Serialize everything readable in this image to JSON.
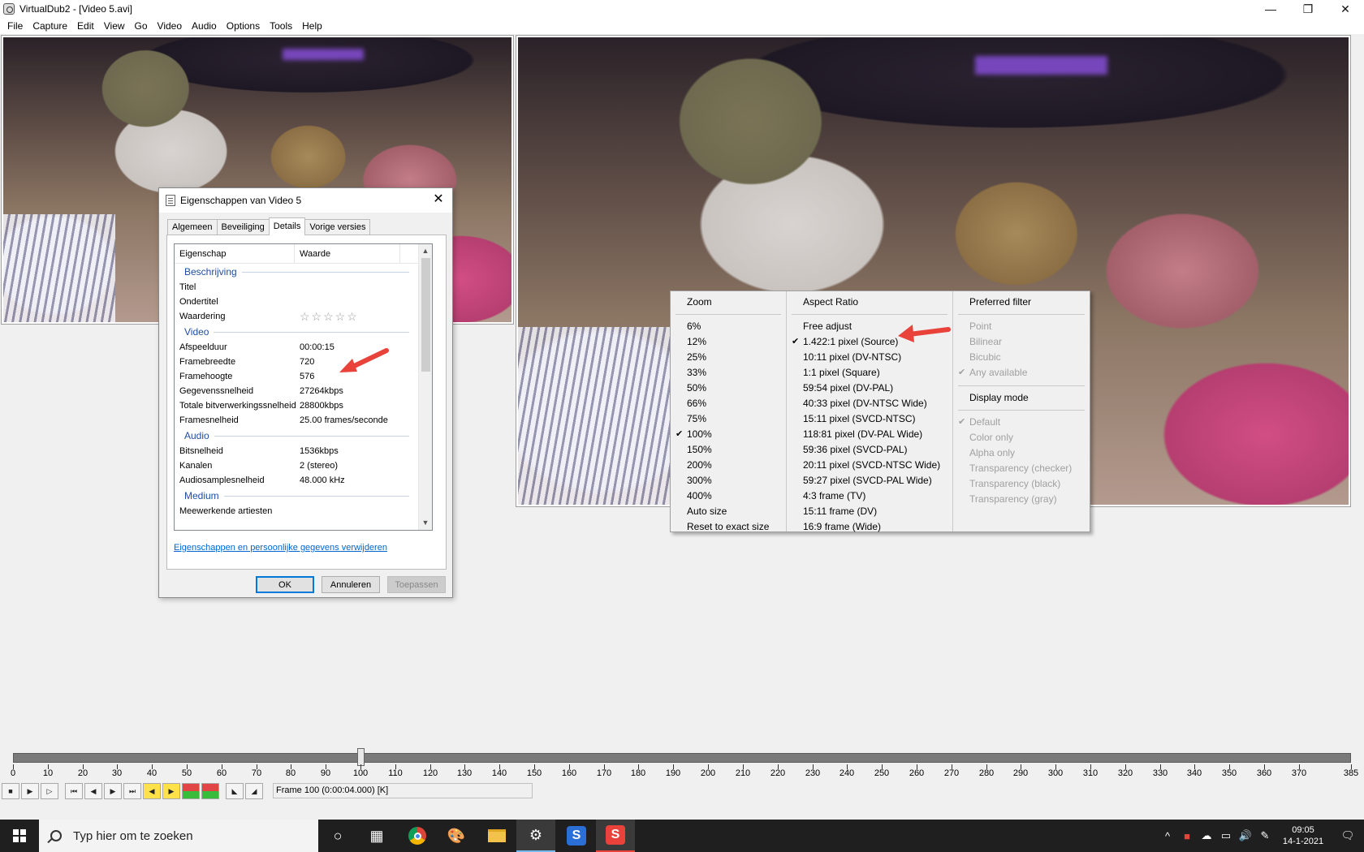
{
  "window": {
    "title": "VirtualDub2  - [Video 5.avi]",
    "controls": {
      "minimize": "—",
      "restore": "❐",
      "close": "✕"
    }
  },
  "menubar": [
    "File",
    "Capture",
    "Edit",
    "View",
    "Go",
    "Video",
    "Audio",
    "Options",
    "Tools",
    "Help"
  ],
  "props_dialog": {
    "title": "Eigenschappen van Video 5",
    "close": "✕",
    "tabs": [
      "Algemeen",
      "Beveiliging",
      "Details",
      "Vorige versies"
    ],
    "active_tab": "Details",
    "columns": [
      "Eigenschap",
      "Waarde"
    ],
    "groups": [
      {
        "name": "Beschrijving",
        "rows": [
          {
            "k": "Titel",
            "v": ""
          },
          {
            "k": "Ondertitel",
            "v": ""
          },
          {
            "k": "Waardering",
            "v": "☆☆☆☆☆"
          }
        ]
      },
      {
        "name": "Video",
        "rows": [
          {
            "k": "Afspeelduur",
            "v": "00:00:15"
          },
          {
            "k": "Framebreedte",
            "v": "720"
          },
          {
            "k": "Framehoogte",
            "v": "576"
          },
          {
            "k": "Gegevenssnelheid",
            "v": "27264kbps"
          },
          {
            "k": "Totale bitverwerkingssnelheid",
            "v": "28800kbps"
          },
          {
            "k": "Framesnelheid",
            "v": "25.00 frames/seconde"
          }
        ]
      },
      {
        "name": "Audio",
        "rows": [
          {
            "k": "Bitsnelheid",
            "v": "1536kbps"
          },
          {
            "k": "Kanalen",
            "v": "2 (stereo)"
          },
          {
            "k": "Audiosamplesnelheid",
            "v": "48.000 kHz"
          }
        ]
      },
      {
        "name": "Medium",
        "rows": [
          {
            "k": "Meewerkende artiesten",
            "v": ""
          }
        ]
      }
    ],
    "link": "Eigenschappen en persoonlijke gegevens verwijderen",
    "buttons": {
      "ok": "OK",
      "cancel": "Annuleren",
      "apply": "Toepassen"
    }
  },
  "context_menu": {
    "zoom": {
      "header": "Zoom",
      "items": [
        "6%",
        "12%",
        "25%",
        "33%",
        "50%",
        "66%",
        "75%",
        "100%",
        "150%",
        "200%",
        "300%",
        "400%",
        "Auto size",
        "Reset to exact size"
      ],
      "checked": "100%"
    },
    "aspect": {
      "header": "Aspect Ratio",
      "items": [
        "Free adjust",
        "1.422:1 pixel (Source)",
        "10:11 pixel (DV-NTSC)",
        "1:1 pixel (Square)",
        "59:54 pixel (DV-PAL)",
        "40:33 pixel (DV-NTSC Wide)",
        "15:11 pixel (SVCD-NTSC)",
        "118:81 pixel (DV-PAL Wide)",
        "59:36 pixel (SVCD-PAL)",
        "20:11 pixel (SVCD-NTSC Wide)",
        "59:27 pixel (SVCD-PAL Wide)",
        "4:3 frame (TV)",
        "15:11 frame (DV)",
        "16:9 frame (Wide)"
      ],
      "checked": "1.422:1 pixel (Source)"
    },
    "filter": {
      "header": "Preferred filter",
      "items": [
        "Point",
        "Bilinear",
        "Bicubic",
        "Any available"
      ],
      "checked": "Any available"
    },
    "display": {
      "header": "Display mode",
      "items": [
        "Default",
        "Color only",
        "Alpha only",
        "Transparency (checker)",
        "Transparency (black)",
        "Transparency (gray)"
      ],
      "checked": "Default"
    },
    "check_mark": "✔"
  },
  "timeline": {
    "current_frame": 100,
    "max_frame": 385,
    "tick_labels": [
      "0",
      "10",
      "20",
      "30",
      "40",
      "50",
      "60",
      "70",
      "80",
      "90",
      "100",
      "110",
      "120",
      "130",
      "140",
      "150",
      "160",
      "170",
      "180",
      "190",
      "200",
      "210",
      "220",
      "230",
      "240",
      "250",
      "260",
      "270",
      "280",
      "290",
      "300",
      "310",
      "320",
      "330",
      "340",
      "350",
      "360",
      "370",
      "385"
    ]
  },
  "status": {
    "frame": "Frame 100 (0:00:04.000) [K]"
  },
  "taskbar": {
    "search_placeholder": "Typ hier om te zoeken",
    "time": "09:05",
    "date": "14-1-2021"
  },
  "colors": {
    "accent": "#0078d7",
    "arrow": "#e8423a",
    "group_header": "#1e4e9e",
    "link": "#0066cc"
  }
}
